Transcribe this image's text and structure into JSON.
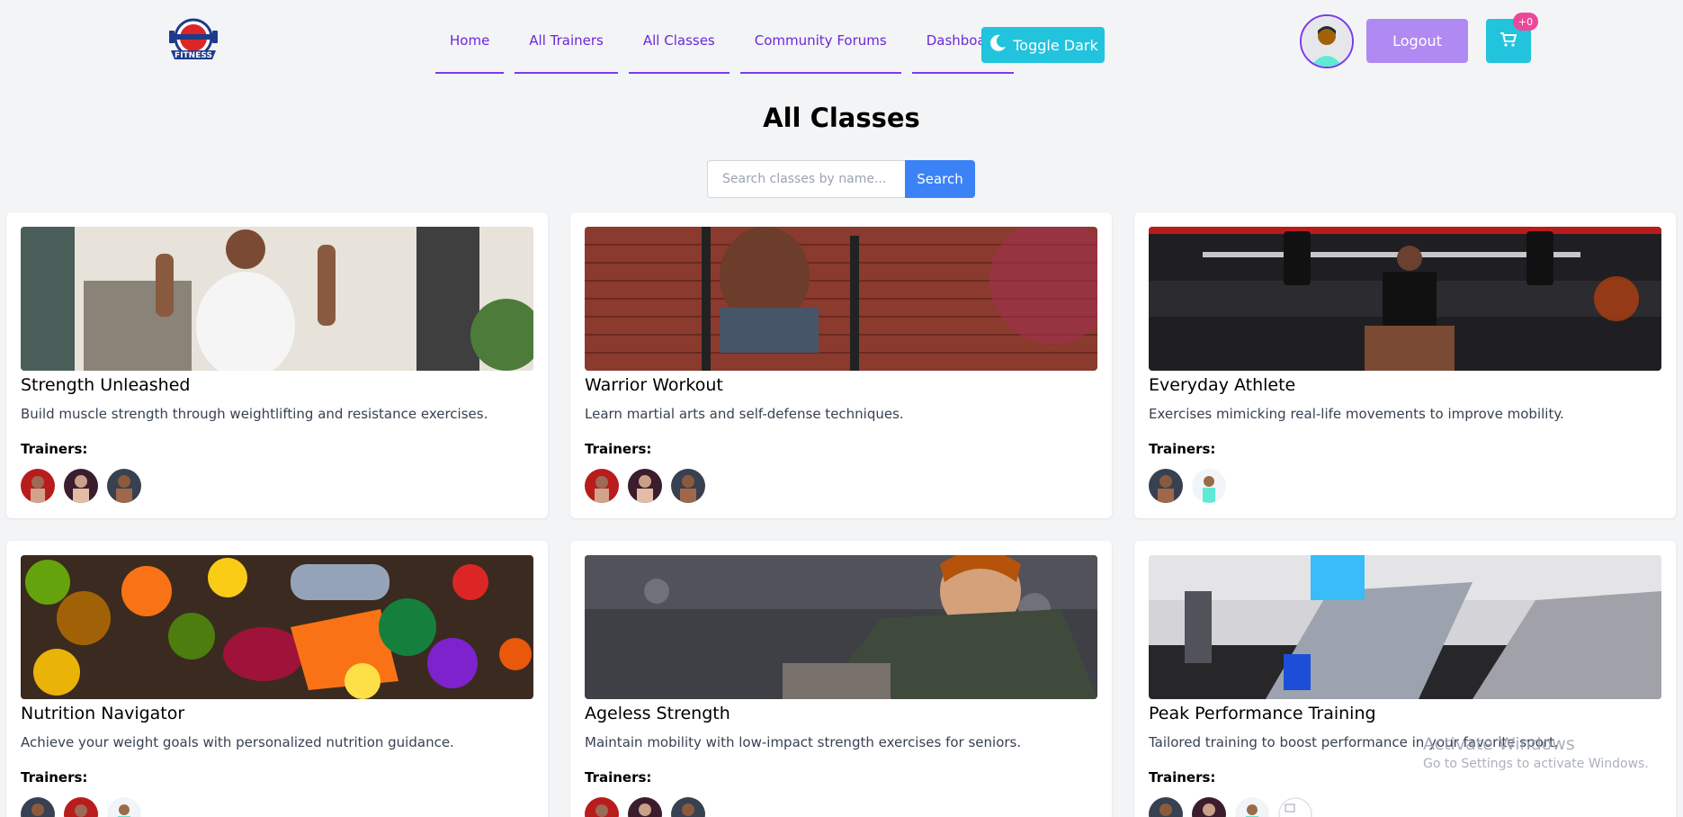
{
  "nav": {
    "logo_label": "FITNESS",
    "links": [
      "Home",
      "All Trainers",
      "All Classes",
      "Community Forums",
      "Dashboard"
    ],
    "toggle_label": "Toggle Dark",
    "logout_label": "Logout",
    "cart_badge": "+0"
  },
  "page": {
    "title": "All Classes",
    "search_placeholder": "Search classes by name...",
    "search_button": "Search"
  },
  "classes": [
    {
      "title": "Strength Unleashed",
      "description": "Build muscle strength through weightlifting and resistance exercises.",
      "trainers_label": "Trainers:",
      "trainer_count": 3
    },
    {
      "title": "Warrior Workout",
      "description": "Learn martial arts and self-defense techniques.",
      "trainers_label": "Trainers:",
      "trainer_count": 3
    },
    {
      "title": "Everyday Athlete",
      "description": "Exercises mimicking real-life movements to improve mobility.",
      "trainers_label": "Trainers:",
      "trainer_count": 2
    },
    {
      "title": "Nutrition Navigator",
      "description": "Achieve your weight goals with personalized nutrition guidance.",
      "trainers_label": "Trainers:",
      "trainer_count": 3
    },
    {
      "title": "Ageless Strength",
      "description": "Maintain mobility with low-impact strength exercises for seniors.",
      "trainers_label": "Trainers:",
      "trainer_count": 3
    },
    {
      "title": "Peak Performance Training",
      "description": "Tailored training to boost performance in your favorite sport.",
      "trainers_label": "Trainers:",
      "trainer_count": 4
    }
  ],
  "watermark": {
    "title": "Activate Windows",
    "subtitle": "Go to Settings to activate Windows."
  },
  "colors": {
    "accent": "#7c3aed",
    "cyan": "#22c3dd",
    "logout": "#b08af2",
    "search": "#3b82f6",
    "badge": "#ec4899"
  }
}
